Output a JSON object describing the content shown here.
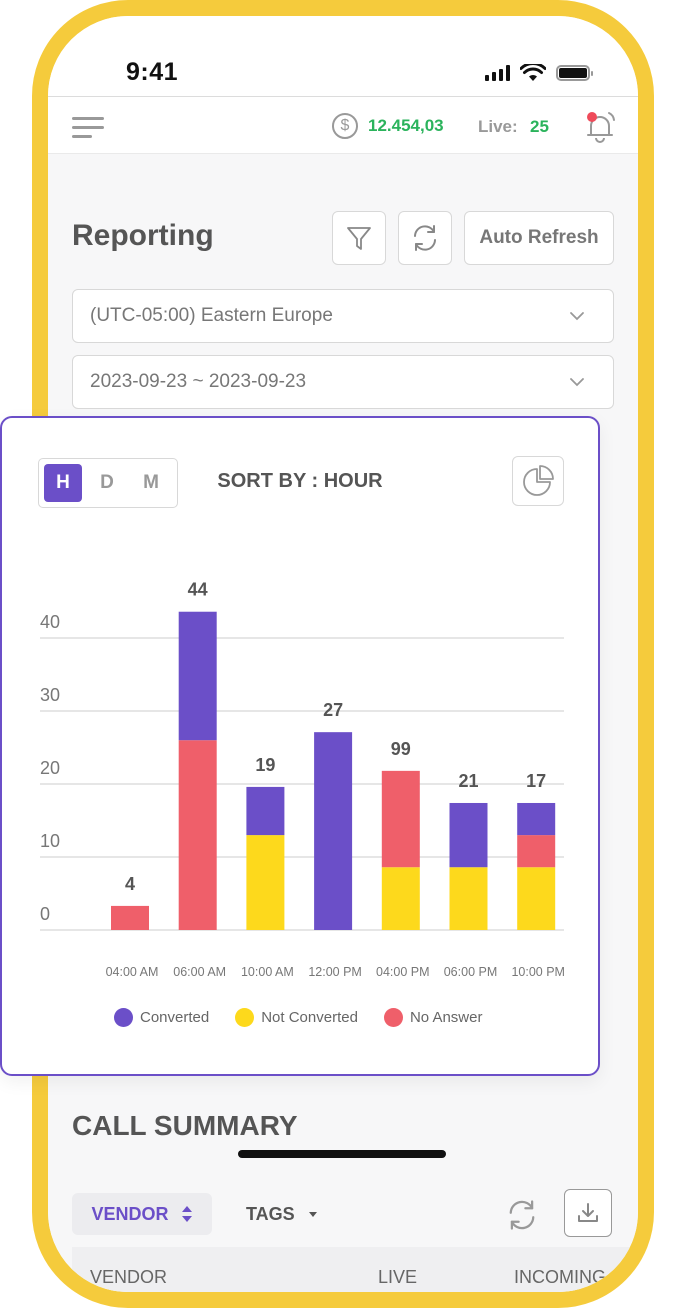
{
  "status_bar": {
    "time": "9:41"
  },
  "top_bar": {
    "menu_icon": "hamburger-menu-icon",
    "balance_icon": "dollar-circle-icon",
    "balance": "12.454,03",
    "live_label": "Live:",
    "live_count": "25",
    "notification_icon": "bell-icon"
  },
  "header": {
    "title": "Reporting",
    "filter_icon": "filter-icon",
    "refresh_icon": "refresh-icon",
    "auto_refresh_label": "Auto Refresh"
  },
  "filters": {
    "timezone": "(UTC-05:00) Eastern Europe",
    "date_range": "2023-09-23 ~ 2023-09-23"
  },
  "chart_card": {
    "period_toggle": [
      {
        "label": "H",
        "active": true
      },
      {
        "label": "D",
        "active": false
      },
      {
        "label": "M",
        "active": false
      }
    ],
    "sort_label": "SORT BY : HOUR",
    "pie_icon": "pie-chart-icon"
  },
  "colors": {
    "converted": "#6b4fc8",
    "not_converted": "#fdd91c",
    "no_answer": "#ef5f6a",
    "accent": "#6b4fc8",
    "positive": "#2bb35c",
    "frame": "#f5cb3c"
  },
  "chart_data": {
    "type": "bar",
    "stacked": true,
    "title": "SORT BY : HOUR",
    "xlabel": "",
    "ylabel": "",
    "ylim": [
      0,
      40
    ],
    "yticks": [
      0,
      10,
      20,
      30,
      40
    ],
    "grid": true,
    "legend_position": "bottom",
    "categories": [
      "04:00 AM",
      "06:00 AM",
      "10:00 AM",
      "12:00 PM",
      "04:00 PM",
      "06:00 PM",
      "10:00 PM"
    ],
    "series": [
      {
        "name": "Not Converted",
        "color": "#fdd91c",
        "values": [
          0,
          0,
          13,
          0,
          8.6,
          8.6,
          8.6
        ]
      },
      {
        "name": "No Answer",
        "color": "#ef5f6a",
        "values": [
          3.3,
          26,
          0,
          0,
          13.2,
          0,
          4.4
        ]
      },
      {
        "name": "Converted",
        "color": "#6b4fc8",
        "values": [
          0,
          17.6,
          6.6,
          27.1,
          0,
          8.8,
          4.4
        ]
      }
    ],
    "data_labels": [
      "4",
      "44",
      "19",
      "27",
      "99",
      "21",
      "17"
    ],
    "legend": [
      "Converted",
      "Not Converted",
      "No Answer"
    ]
  },
  "call_summary": {
    "title": "CALL SUMMARY",
    "vendor_filter": "VENDOR",
    "tags_filter": "TAGS",
    "refresh_icon": "refresh-icon",
    "download_icon": "download-icon",
    "columns": [
      "VENDOR",
      "LIVE",
      "INCOMING"
    ]
  }
}
